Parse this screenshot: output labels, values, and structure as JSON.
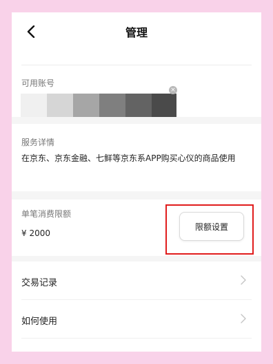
{
  "header": {
    "title": "管理",
    "back_icon": "chevron-left-icon"
  },
  "account": {
    "label": "可用账号",
    "swatches": [
      "#f0f0f0",
      "#d6d6d6",
      "#a6a6a6",
      "#7f7f7f",
      "#636363",
      "#4a4a4a"
    ],
    "remove_icon": "close-icon"
  },
  "service": {
    "label": "服务详情",
    "detail": "在京东、京东金融、七鲜等京东系APP购买心仪的商品使用"
  },
  "limit": {
    "label": "单笔消费限额",
    "amount": "¥ 2000",
    "button_label": "限额设置",
    "highlight_color": "#e01b1b"
  },
  "menu": [
    {
      "label": "交易记录",
      "icon": "chevron-right-icon"
    },
    {
      "label": "如何使用",
      "icon": "chevron-right-icon"
    }
  ],
  "colors": {
    "background": "#f9d2e9",
    "panel": "#ffffff",
    "separator": "#f5f5f5"
  }
}
